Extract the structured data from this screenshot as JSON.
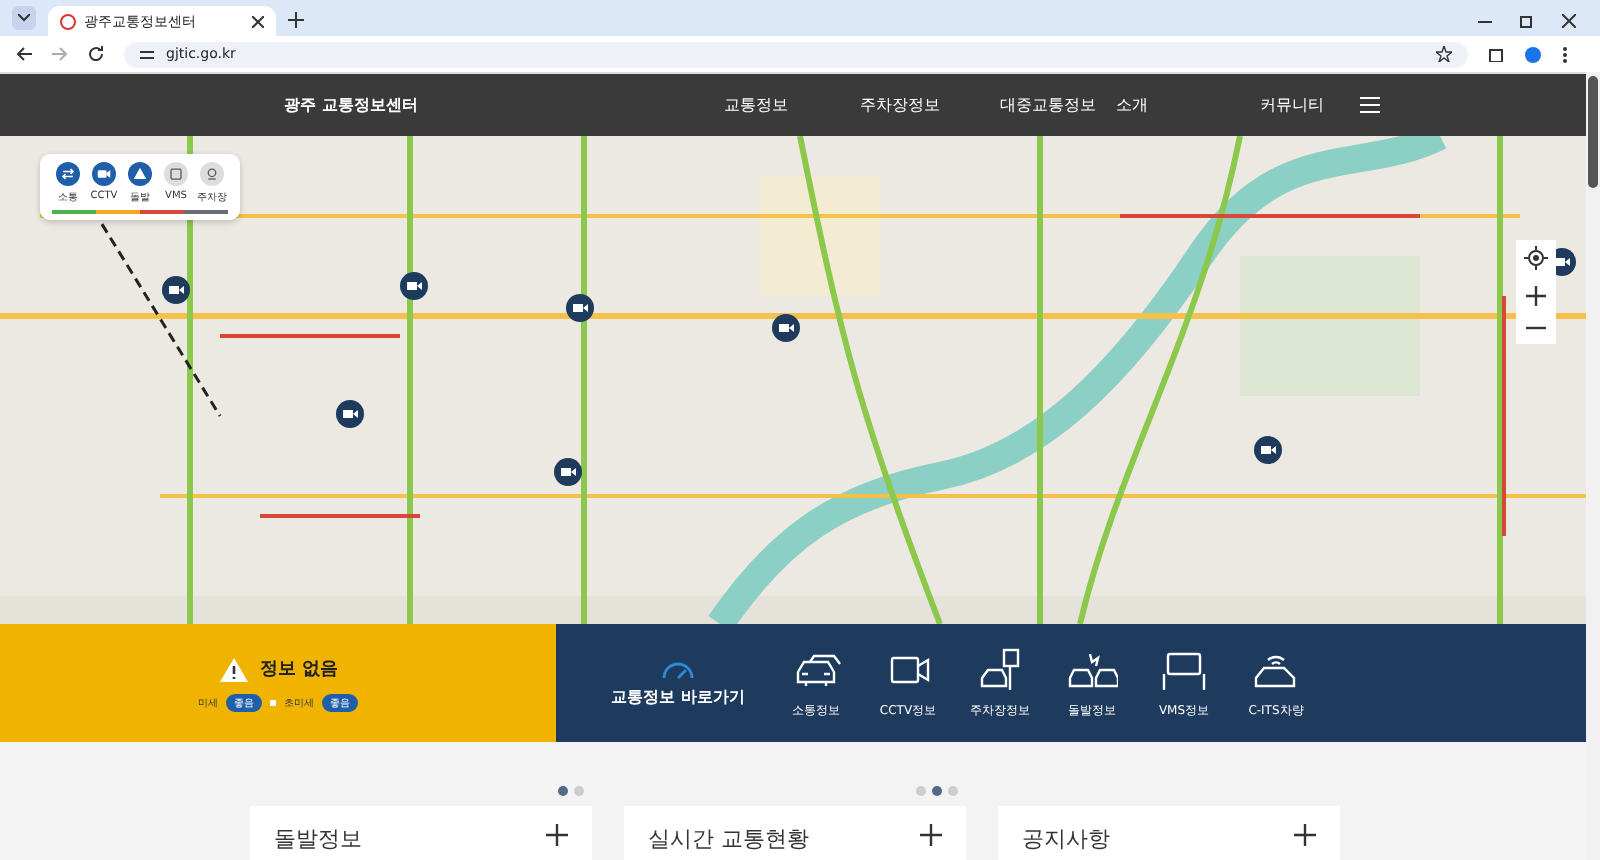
{
  "browser": {
    "tab_title": "광주교통정보센터",
    "url": "gjtic.go.kr"
  },
  "header": {
    "logo": "광주 교통정보센터",
    "nav": [
      {
        "label": "교통정보"
      },
      {
        "label": "주차장정보"
      },
      {
        "label": "대중교통정보"
      },
      {
        "label": "소개"
      },
      {
        "label": "커뮤니티"
      }
    ]
  },
  "map_legend": [
    {
      "label": "소통",
      "kind": "traffic",
      "selected": true
    },
    {
      "label": "CCTV",
      "kind": "cctv",
      "selected": true
    },
    {
      "label": "돌발",
      "kind": "incident",
      "selected": true
    },
    {
      "label": "VMS",
      "kind": "vms",
      "selected": false
    },
    {
      "label": "주차장",
      "kind": "parking",
      "selected": false
    }
  ],
  "air_quality": {
    "status": "정보 없음",
    "items": [
      {
        "label": "미세",
        "grade": "좋음"
      },
      {
        "label": "초미세",
        "grade": "좋음"
      }
    ]
  },
  "quick_links": {
    "title": "교통정보 바로가기",
    "items": [
      {
        "label": "소통정보",
        "kind": "traffic"
      },
      {
        "label": "CCTV정보",
        "kind": "cctv"
      },
      {
        "label": "주차장정보",
        "kind": "parking"
      },
      {
        "label": "돌발정보",
        "kind": "incident"
      },
      {
        "label": "VMS정보",
        "kind": "vms"
      },
      {
        "label": "C-ITS차량",
        "kind": "cits"
      }
    ]
  },
  "cards": [
    {
      "title": "돌발정보",
      "pager": [
        {
          "selected": true
        },
        {
          "selected": false
        }
      ]
    },
    {
      "title": "실시간 교통현황",
      "pager": [
        {
          "selected": false
        },
        {
          "selected": true
        },
        {
          "selected": false
        }
      ]
    },
    {
      "title": "공지사항"
    }
  ]
}
